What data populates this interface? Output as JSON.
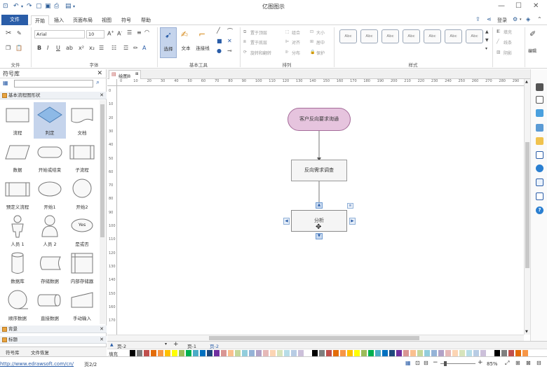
{
  "window": {
    "title": "亿图图示"
  },
  "ribbon_tabs": [
    "文件",
    "开始",
    "插入",
    "页面布局",
    "视图",
    "符号",
    "帮助"
  ],
  "titlebar_right": {
    "login": "登录"
  },
  "font": {
    "name": "Arial",
    "size": "10"
  },
  "tools": {
    "select": "选择",
    "text": "文本",
    "connector": "连接线"
  },
  "arrange": {
    "bring_front": "置于顶层",
    "send_back": "置于底层",
    "rotate": "旋转和翻转",
    "group": "组合",
    "align": "对齐",
    "distribute": "分布",
    "size": "大小",
    "center": "居中",
    "protect": "保护"
  },
  "style_items": {
    "fill": "填充",
    "line": "线条",
    "shadow": "阴影",
    "abc": "Abc",
    "edit": "编辑"
  },
  "group_labels": {
    "file": "文件",
    "font": "字体",
    "basic_tools": "基本工具",
    "arrange": "排列",
    "style": "样式"
  },
  "symbol_library": {
    "title": "符号库",
    "categories": [
      "基本流程图形状",
      "背景",
      "标题"
    ],
    "shapes": [
      "流程",
      "判定",
      "文档",
      "数据",
      "开始或结束",
      "子流程",
      "预定义流程",
      "开始1",
      "开始2",
      "人员 1",
      "人员 2",
      "是或否",
      "数据库",
      "存储数据",
      "内部存储器",
      "顺序数据",
      "直接数据",
      "手动输入"
    ],
    "yes_label": "Yes",
    "bottom_tabs": [
      "符号库",
      "文件恢复"
    ]
  },
  "doc_tab": "绘图8",
  "ruler_labels": [
    "0",
    "10",
    "20",
    "30",
    "40",
    "50",
    "60",
    "70",
    "80",
    "90",
    "100",
    "110",
    "120",
    "130",
    "140",
    "150",
    "160",
    "170",
    "180",
    "190",
    "200",
    "210",
    "220",
    "230",
    "240",
    "250",
    "260",
    "270",
    "280",
    "290"
  ],
  "diagram": {
    "start": "客户反向要求询通",
    "process": "反向需求调查",
    "analysis": "分析"
  },
  "page_tabs": {
    "current": "页-2",
    "p1": "页-1",
    "p2": "页-2"
  },
  "palette_label": "填充",
  "status": {
    "url": "http://www.edrawsoft.com/cn/",
    "page": "页2/2",
    "zoom": "85%"
  },
  "colors": {
    "brand": "#2a5da8",
    "terminator_fill": "#e6c4de",
    "terminator_stroke": "#a46b99"
  }
}
